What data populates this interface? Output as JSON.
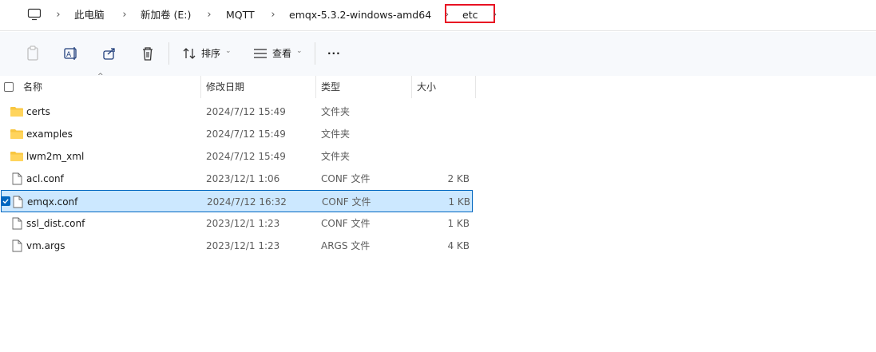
{
  "breadcrumb": {
    "items": [
      "此电脑",
      "新加卷 (E:)",
      "MQTT",
      "emqx-5.3.2-windows-amd64",
      "etc"
    ]
  },
  "toolbar": {
    "sort_label": "排序",
    "view_label": "查看",
    "more_label": "···"
  },
  "columns": {
    "name": "名称",
    "modified": "修改日期",
    "type": "类型",
    "size": "大小"
  },
  "files": [
    {
      "name": "certs",
      "modified": "2024/7/12 15:49",
      "type": "文件夹",
      "size": "",
      "icon": "folder-icon"
    },
    {
      "name": "examples",
      "modified": "2024/7/12 15:49",
      "type": "文件夹",
      "size": "",
      "icon": "folder-icon"
    },
    {
      "name": "lwm2m_xml",
      "modified": "2024/7/12 15:49",
      "type": "文件夹",
      "size": "",
      "icon": "folder-icon"
    },
    {
      "name": "acl.conf",
      "modified": "2023/12/1 1:06",
      "type": "CONF 文件",
      "size": "2 KB",
      "icon": "file-icon"
    },
    {
      "name": "emqx.conf",
      "modified": "2024/7/12 16:32",
      "type": "CONF 文件",
      "size": "1 KB",
      "icon": "file-icon",
      "selected": true
    },
    {
      "name": "ssl_dist.conf",
      "modified": "2023/12/1 1:23",
      "type": "CONF 文件",
      "size": "1 KB",
      "icon": "file-icon"
    },
    {
      "name": "vm.args",
      "modified": "2023/12/1 1:23",
      "type": "ARGS 文件",
      "size": "4 KB",
      "icon": "file-icon"
    }
  ],
  "colors": {
    "selection_bg": "#cce8ff",
    "selection_border": "#0067c0",
    "highlight_box": "#e81123",
    "folder": "#f8c640"
  }
}
